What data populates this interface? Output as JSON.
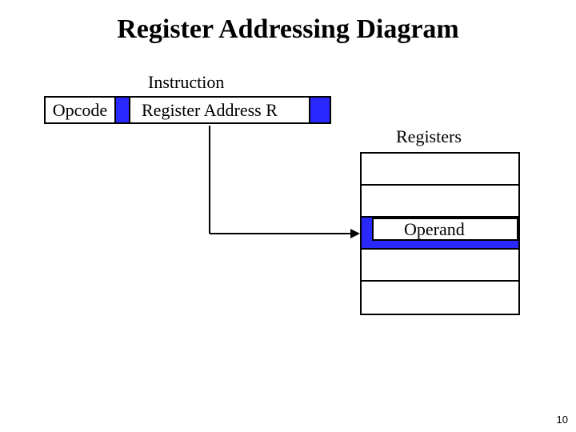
{
  "title": "Register Addressing Diagram",
  "instruction_label": "Instruction",
  "opcode_label": "Opcode",
  "register_address_label": "Register Address R",
  "registers_label": "Registers",
  "operand_label": "Operand",
  "page_number": "10",
  "colors": {
    "highlight": "#2929ff"
  }
}
